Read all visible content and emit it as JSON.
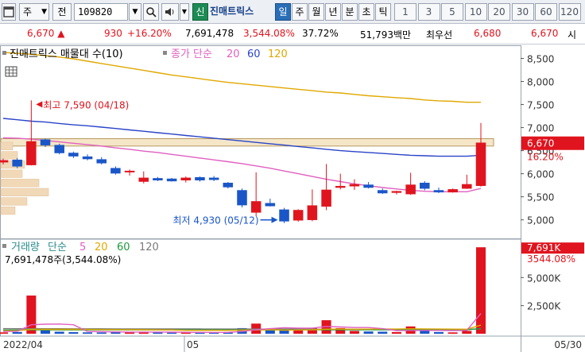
{
  "toolbar": {
    "market_selector": "주",
    "period_selector": "전",
    "stock_code": "109820",
    "sound_icon": "speaker-icon",
    "credit_badge": "신",
    "stock_name": "진매트릭스",
    "periods": [
      "일",
      "주",
      "월",
      "년",
      "분",
      "초",
      "틱"
    ],
    "active_period": "일",
    "intervals": [
      "1",
      "3",
      "5",
      "10",
      "20",
      "30",
      "60",
      "120"
    ]
  },
  "quote": {
    "price": "6,670",
    "change": "930",
    "change_pct": "+16.20%",
    "volume": "7,691,478",
    "volume_ratio": "3,544.08%",
    "turnover_pct": "37.72%",
    "trade_value": "51,793백만",
    "best_bid_label": "최우선",
    "best_ask": "6,680",
    "best_bid": "6,670",
    "open_label": "시"
  },
  "chart_data": [
    {
      "type": "candlestick",
      "title": "진매트릭스 매물대 수(10)",
      "legend": {
        "label": "종가 단순",
        "ma_periods": [
          "20",
          "60",
          "120"
        ]
      },
      "ma_colors": {
        "20": "#e060c0",
        "60": "#2a44c8",
        "120": "#e0a800"
      },
      "up_color": "#e0141e",
      "down_color": "#1a56c8",
      "x_start_label": "2022/04",
      "x_mid_label": "05",
      "x_end_label": "05/30",
      "y_ticks": [
        5000,
        5500,
        6000,
        6500,
        7000,
        7500,
        8000,
        8500
      ],
      "y_tick_labels": [
        "5,000",
        "5,500",
        "6,000",
        "6,500",
        "7,000",
        "7,500",
        "8,000",
        "8,500"
      ],
      "ylim": [
        4650,
        8750
      ],
      "current_price_label": "6,670",
      "current_change_label": "16.20%",
      "high_annotation": "최고 7,590 (04/18)",
      "low_annotation": "최저 4,930 (05/12)",
      "candles": [
        {
          "o": 6250,
          "h": 6330,
          "l": 6200,
          "c": 6290
        },
        {
          "o": 6300,
          "h": 6340,
          "l": 6120,
          "c": 6160
        },
        {
          "o": 6190,
          "h": 7590,
          "l": 6180,
          "c": 6700
        },
        {
          "o": 6740,
          "h": 6760,
          "l": 6580,
          "c": 6620
        },
        {
          "o": 6620,
          "h": 6650,
          "l": 6420,
          "c": 6450
        },
        {
          "o": 6450,
          "h": 6480,
          "l": 6340,
          "c": 6380
        },
        {
          "o": 6370,
          "h": 6420,
          "l": 6290,
          "c": 6320
        },
        {
          "o": 6310,
          "h": 6360,
          "l": 6200,
          "c": 6230
        },
        {
          "o": 6120,
          "h": 6160,
          "l": 5980,
          "c": 6010
        },
        {
          "o": 6040,
          "h": 6090,
          "l": 5960,
          "c": 6060
        },
        {
          "o": 5830,
          "h": 6050,
          "l": 5790,
          "c": 5910
        },
        {
          "o": 5900,
          "h": 5930,
          "l": 5840,
          "c": 5860
        },
        {
          "o": 5890,
          "h": 5910,
          "l": 5830,
          "c": 5840
        },
        {
          "o": 5860,
          "h": 5940,
          "l": 5810,
          "c": 5910
        },
        {
          "o": 5920,
          "h": 5940,
          "l": 5830,
          "c": 5860
        },
        {
          "o": 5910,
          "h": 5950,
          "l": 5840,
          "c": 5870
        },
        {
          "o": 5800,
          "h": 5820,
          "l": 5680,
          "c": 5710
        },
        {
          "o": 5640,
          "h": 5680,
          "l": 5270,
          "c": 5320
        },
        {
          "o": 5160,
          "h": 6030,
          "l": 5080,
          "c": 5400
        },
        {
          "o": 5360,
          "h": 5460,
          "l": 5290,
          "c": 5300
        },
        {
          "o": 5220,
          "h": 5260,
          "l": 4930,
          "c": 4970
        },
        {
          "o": 4990,
          "h": 5230,
          "l": 4960,
          "c": 5210
        },
        {
          "o": 5000,
          "h": 5660,
          "l": 4970,
          "c": 5310
        },
        {
          "o": 5290,
          "h": 6210,
          "l": 5210,
          "c": 5650
        },
        {
          "o": 5700,
          "h": 6000,
          "l": 5660,
          "c": 5730
        },
        {
          "o": 5730,
          "h": 5880,
          "l": 5650,
          "c": 5770
        },
        {
          "o": 5760,
          "h": 5820,
          "l": 5680,
          "c": 5700
        },
        {
          "o": 5640,
          "h": 5680,
          "l": 5560,
          "c": 5580
        },
        {
          "o": 5590,
          "h": 5630,
          "l": 5550,
          "c": 5620
        },
        {
          "o": 5560,
          "h": 6020,
          "l": 5540,
          "c": 5760
        },
        {
          "o": 5800,
          "h": 5840,
          "l": 5640,
          "c": 5680
        },
        {
          "o": 5640,
          "h": 5700,
          "l": 5580,
          "c": 5600
        },
        {
          "o": 5600,
          "h": 5680,
          "l": 5590,
          "c": 5660
        },
        {
          "o": 5680,
          "h": 5980,
          "l": 5670,
          "c": 5770
        },
        {
          "o": 5740,
          "h": 7100,
          "l": 5720,
          "c": 6670
        }
      ],
      "ma20": [
        6780,
        6770,
        6750,
        6720,
        6690,
        6660,
        6630,
        6600,
        6560,
        6530,
        6490,
        6460,
        6420,
        6380,
        6340,
        6300,
        6260,
        6220,
        6170,
        6120,
        6060,
        6000,
        5940,
        5880,
        5830,
        5780,
        5740,
        5700,
        5670,
        5640,
        5620,
        5610,
        5610,
        5610,
        5680
      ],
      "ma60": [
        7200,
        7170,
        7140,
        7120,
        7090,
        7060,
        7040,
        7010,
        6980,
        6950,
        6920,
        6890,
        6860,
        6830,
        6800,
        6770,
        6740,
        6710,
        6680,
        6650,
        6620,
        6590,
        6560,
        6530,
        6500,
        6480,
        6460,
        6440,
        6420,
        6400,
        6390,
        6380,
        6380,
        6380,
        6400
      ],
      "ma120": [
        8630,
        8610,
        8590,
        8560,
        8530,
        8490,
        8440,
        8390,
        8340,
        8290,
        8240,
        8190,
        8140,
        8100,
        8060,
        8020,
        7980,
        7950,
        7920,
        7890,
        7860,
        7830,
        7800,
        7770,
        7750,
        7720,
        7690,
        7670,
        7650,
        7630,
        7600,
        7580,
        7570,
        7550,
        7550
      ],
      "volume_profile": [
        {
          "low": 6500,
          "high": 6700,
          "w": 0.25
        },
        {
          "low": 6300,
          "high": 6500,
          "w": 0.35
        },
        {
          "low": 6100,
          "high": 6300,
          "w": 0.5
        },
        {
          "low": 5900,
          "high": 6100,
          "w": 0.45
        },
        {
          "low": 5700,
          "high": 5900,
          "w": 0.8
        },
        {
          "low": 5500,
          "high": 5700,
          "w": 1.0
        },
        {
          "low": 5300,
          "high": 5500,
          "w": 0.55
        },
        {
          "low": 5100,
          "high": 5300,
          "w": 0.3
        }
      ],
      "profile_band": [
        6600,
        6760
      ]
    },
    {
      "type": "bar",
      "title": "거래량",
      "legend": {
        "label": "단순",
        "ma_periods": [
          "5",
          "20",
          "60",
          "120"
        ]
      },
      "ma_colors": {
        "5": "#e060c0",
        "20": "#e0a800",
        "60": "#1c9a3c",
        "120": "#7a7a7a"
      },
      "info": "7,691,478주(3,544.08%)",
      "y_ticks": [
        2500000,
        5000000
      ],
      "y_tick_labels": [
        "2,500K",
        "5,000K"
      ],
      "ylim": [
        0,
        8200000
      ],
      "current_label": "7,691K",
      "current_pct_label": "3544.08%",
      "values": [
        120000,
        150000,
        3400000,
        300000,
        180000,
        140000,
        120000,
        110000,
        200000,
        150000,
        180000,
        120000,
        100000,
        110000,
        100000,
        120000,
        150000,
        500000,
        900000,
        350000,
        450000,
        300000,
        500000,
        1200000,
        500000,
        250000,
        200000,
        180000,
        150000,
        650000,
        300000,
        150000,
        120000,
        250000,
        7691478
      ],
      "ma5": [
        200000,
        220000,
        800000,
        850000,
        860000,
        800000,
        200000,
        180000,
        160000,
        150000,
        150000,
        150000,
        140000,
        130000,
        120000,
        110000,
        120000,
        200000,
        350000,
        450000,
        530000,
        500000,
        500000,
        650000,
        600000,
        550000,
        550000,
        450000,
        280000,
        290000,
        300000,
        300000,
        280000,
        300000,
        1800000
      ],
      "ma20": [
        260000,
        270000,
        380000,
        390000,
        390000,
        390000,
        380000,
        370000,
        370000,
        360000,
        350000,
        340000,
        330000,
        300000,
        300000,
        300000,
        300000,
        310000,
        340000,
        350000,
        320000,
        330000,
        350000,
        400000,
        410000,
        400000,
        410000,
        420000,
        420000,
        440000,
        430000,
        420000,
        410000,
        400000,
        760000
      ],
      "ma60": [
        330000,
        330000,
        340000,
        340000,
        340000,
        340000,
        340000,
        340000,
        340000,
        340000,
        340000,
        340000,
        340000,
        340000,
        340000,
        340000,
        340000,
        340000,
        340000,
        340000,
        340000,
        340000,
        345000,
        350000,
        350000,
        350000,
        350000,
        350000,
        350000,
        355000,
        355000,
        355000,
        355000,
        355000,
        470000
      ],
      "ma120": [
        450000,
        448000,
        446000,
        444000,
        442000,
        440000,
        438000,
        436000,
        434000,
        432000,
        430000,
        428000,
        426000,
        424000,
        422000,
        420000,
        418000,
        416000,
        414000,
        412000,
        410000,
        408000,
        406000,
        404000,
        402000,
        400000,
        398000,
        396000,
        394000,
        392000,
        390000,
        388000,
        386000,
        384000,
        440000
      ]
    }
  ]
}
